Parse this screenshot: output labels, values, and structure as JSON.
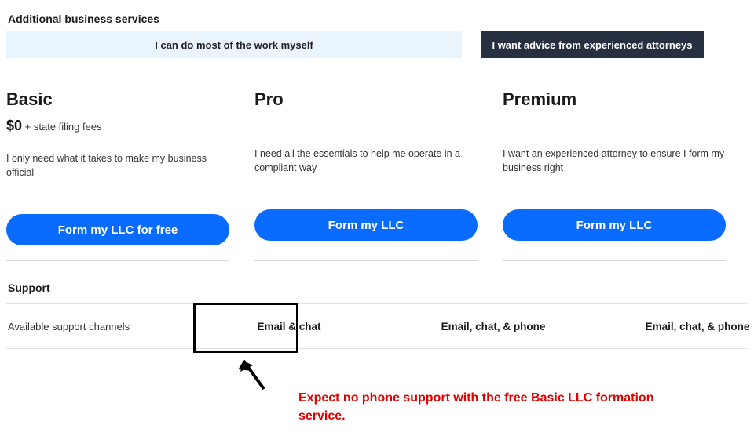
{
  "section_title": "Additional business services",
  "banners": {
    "self": "I can do most of the work myself",
    "attorney": "I want advice from experienced attorneys"
  },
  "plans": {
    "basic": {
      "name": "Basic",
      "price_amount": "$0",
      "price_suffix": " + state filing fees",
      "desc": "I only need what it takes to make my business official",
      "cta": "Form my LLC for free"
    },
    "pro": {
      "name": "Pro",
      "desc": "I need all the essentials to help me operate in a compliant way",
      "cta": "Form my LLC"
    },
    "premium": {
      "name": "Premium",
      "desc": "I want an experienced attorney to ensure I form my business right",
      "cta": "Form my LLC"
    }
  },
  "support": {
    "section_label": "Support",
    "feature_label": "Available support channels",
    "basic": "Email & chat",
    "pro": "Email, chat, & phone",
    "premium": "Email, chat, & phone"
  },
  "annotation": {
    "text": "Expect no phone support with the free Basic LLC formation service."
  }
}
